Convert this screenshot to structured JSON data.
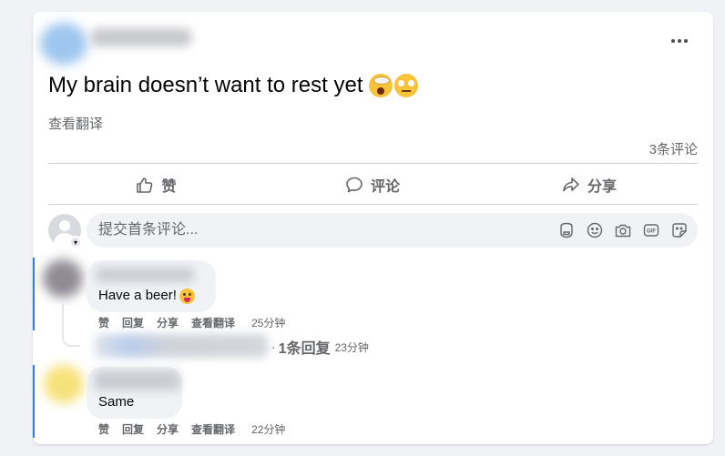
{
  "post": {
    "text": "My brain doesn’t want to rest yet",
    "emojis": [
      "exploding-head-emoji",
      "eye-roll-emoji"
    ],
    "translate": "查看翻译",
    "comment_count": "3条评论"
  },
  "actions": {
    "like": "赞",
    "comment": "评论",
    "share": "分享"
  },
  "composer": {
    "placeholder": "提交首条评论...",
    "icons": [
      "avatar-sticker-icon",
      "emoji-icon",
      "camera-icon",
      "gif-icon",
      "sticker-icon"
    ]
  },
  "comments": [
    {
      "text": "Have a beer!",
      "emoji": "winking-tongue-emoji",
      "actions": [
        "赞",
        "回复",
        "分享",
        "查看翻译"
      ],
      "time": "25分钟",
      "replies": {
        "separator": "·",
        "count": "1条回复",
        "time": "23分钟"
      }
    },
    {
      "text": "Same",
      "actions": [
        "赞",
        "回复",
        "分享",
        "查看翻译"
      ],
      "time": "22分钟"
    }
  ],
  "colors": {
    "accent": "#3578e5",
    "secondary_text": "#65676b",
    "bubble": "#f0f2f5",
    "page_bg": "#f0f2f5"
  }
}
